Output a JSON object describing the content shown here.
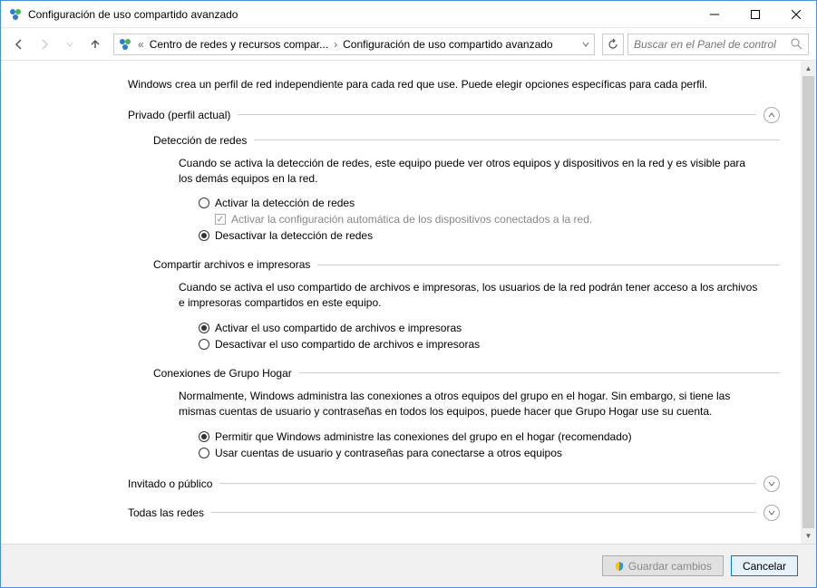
{
  "window": {
    "title": "Configuración de uso compartido avanzado"
  },
  "breadcrumb": {
    "root_sep": "«",
    "item1": "Centro de redes y recursos compar...",
    "item2": "Configuración de uso compartido avanzado"
  },
  "search": {
    "placeholder": "Buscar en el Panel de control"
  },
  "intro": "Windows crea un perfil de red independiente para cada red que use. Puede elegir opciones específicas para cada perfil.",
  "sections": {
    "private": {
      "title": "Privado (perfil actual)",
      "network_discovery": {
        "title": "Detección de redes",
        "desc": "Cuando se activa la detección de redes, este equipo puede ver otros equipos y dispositivos en la red y es visible para los demás equipos en la red.",
        "opt_on": "Activar la detección de redes",
        "opt_auto": "Activar la configuración automática de los dispositivos conectados a la red.",
        "opt_off": "Desactivar la detección de redes"
      },
      "file_sharing": {
        "title": "Compartir archivos e impresoras",
        "desc": "Cuando se activa el uso compartido de archivos e impresoras, los usuarios de la red podrán tener acceso a los archivos e impresoras compartidos en este equipo.",
        "opt_on": "Activar el uso compartido de archivos e impresoras",
        "opt_off": "Desactivar el uso compartido de archivos e impresoras"
      },
      "homegroup": {
        "title": "Conexiones de Grupo Hogar",
        "desc": "Normalmente, Windows administra las conexiones a otros equipos del grupo en el hogar. Sin embargo, si tiene las mismas cuentas de usuario y contraseñas en todos los equipos, puede hacer que Grupo Hogar use su cuenta.",
        "opt_win": "Permitir que Windows administre las conexiones del grupo en el hogar (recomendado)",
        "opt_user": "Usar cuentas de usuario y contraseñas para conectarse a otros equipos"
      }
    },
    "guest": {
      "title": "Invitado o público"
    },
    "all": {
      "title": "Todas las redes"
    }
  },
  "footer": {
    "save": "Guardar cambios",
    "cancel": "Cancelar"
  }
}
